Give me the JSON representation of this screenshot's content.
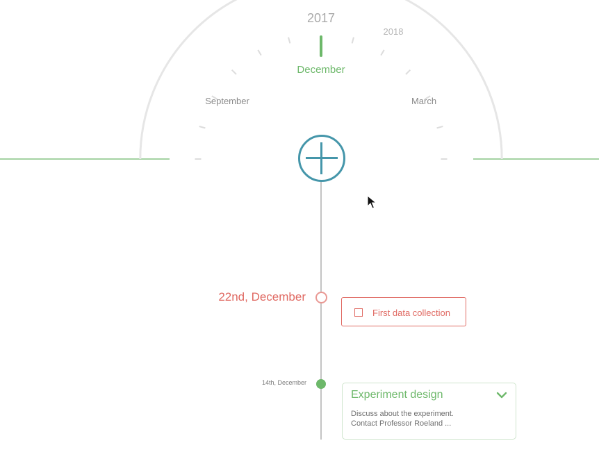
{
  "timeline_dial": {
    "current_year": "2017",
    "next_year": "2018",
    "active_month": "December",
    "left_month": "September",
    "right_month": "March"
  },
  "add_button": {
    "icon": "plus-icon"
  },
  "events": [
    {
      "date": "22nd, December",
      "task": {
        "label": "First data collection",
        "checked": false
      },
      "color": "#e06a63"
    },
    {
      "date": "14th, December",
      "title": "Experiment design",
      "description_lines": [
        "Discuss about the experiment.",
        "Contact Professor Roeland ..."
      ],
      "icon": "chevron-down-icon",
      "color": "#6db86a"
    }
  ],
  "colors": {
    "accent_green": "#6db86a",
    "accent_teal": "#4596aa",
    "accent_red": "#e06a63",
    "dial_gray": "#e6e6e6",
    "axis_gray": "#c4c4c4"
  }
}
